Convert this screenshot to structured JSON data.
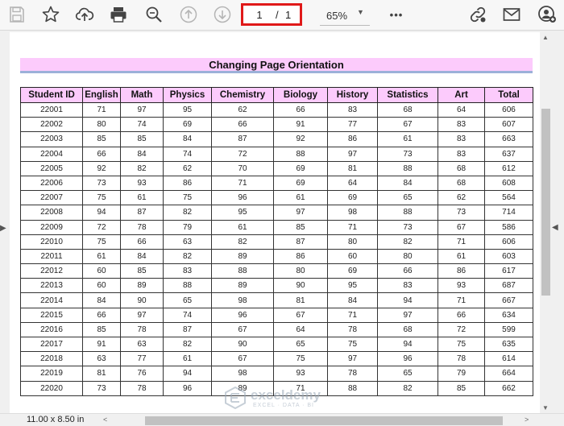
{
  "toolbar": {
    "icons": [
      "save-icon",
      "bookmark-star-icon",
      "upload-cloud-icon",
      "print-icon",
      "zoom-search-icon",
      "previous-page-icon",
      "next-page-icon",
      "more-icon",
      "share-link-icon",
      "email-icon",
      "account-icon"
    ],
    "page_current": "1",
    "page_separator": "/",
    "page_total": "1",
    "zoom_value": "65%",
    "more_label": "•••"
  },
  "status": {
    "page_size": "11.00 x 8.50 in"
  },
  "document": {
    "title": "Changing Page Orientation",
    "columns": [
      "Student ID",
      "English",
      "Math",
      "Physics",
      "Chemistry",
      "Biology",
      "History",
      "Statistics",
      "Art",
      "Total"
    ],
    "rows": [
      [
        "22001",
        "71",
        "97",
        "95",
        "62",
        "66",
        "83",
        "68",
        "64",
        "606"
      ],
      [
        "22002",
        "80",
        "74",
        "69",
        "66",
        "91",
        "77",
        "67",
        "83",
        "607"
      ],
      [
        "22003",
        "85",
        "85",
        "84",
        "87",
        "92",
        "86",
        "61",
        "83",
        "663"
      ],
      [
        "22004",
        "66",
        "84",
        "74",
        "72",
        "88",
        "97",
        "73",
        "83",
        "637"
      ],
      [
        "22005",
        "92",
        "82",
        "62",
        "70",
        "69",
        "81",
        "88",
        "68",
        "612"
      ],
      [
        "22006",
        "73",
        "93",
        "86",
        "71",
        "69",
        "64",
        "84",
        "68",
        "608"
      ],
      [
        "22007",
        "75",
        "61",
        "75",
        "96",
        "61",
        "69",
        "65",
        "62",
        "564"
      ],
      [
        "22008",
        "94",
        "87",
        "82",
        "95",
        "97",
        "98",
        "88",
        "73",
        "714"
      ],
      [
        "22009",
        "72",
        "78",
        "79",
        "61",
        "85",
        "71",
        "73",
        "67",
        "586"
      ],
      [
        "22010",
        "75",
        "66",
        "63",
        "82",
        "87",
        "80",
        "82",
        "71",
        "606"
      ],
      [
        "22011",
        "61",
        "84",
        "82",
        "89",
        "86",
        "60",
        "80",
        "61",
        "603"
      ],
      [
        "22012",
        "60",
        "85",
        "83",
        "88",
        "80",
        "69",
        "66",
        "86",
        "617"
      ],
      [
        "22013",
        "60",
        "89",
        "88",
        "89",
        "90",
        "95",
        "83",
        "93",
        "687"
      ],
      [
        "22014",
        "84",
        "90",
        "65",
        "98",
        "81",
        "84",
        "94",
        "71",
        "667"
      ],
      [
        "22015",
        "66",
        "97",
        "74",
        "96",
        "67",
        "71",
        "97",
        "66",
        "634"
      ],
      [
        "22016",
        "85",
        "78",
        "87",
        "67",
        "64",
        "78",
        "68",
        "72",
        "599"
      ],
      [
        "22017",
        "91",
        "63",
        "82",
        "90",
        "65",
        "75",
        "94",
        "75",
        "635"
      ],
      [
        "22018",
        "63",
        "77",
        "61",
        "67",
        "75",
        "97",
        "96",
        "78",
        "614"
      ],
      [
        "22019",
        "81",
        "76",
        "94",
        "98",
        "93",
        "78",
        "65",
        "79",
        "664"
      ],
      [
        "22020",
        "73",
        "78",
        "96",
        "89",
        "71",
        "88",
        "82",
        "85",
        "662"
      ]
    ]
  },
  "watermark": {
    "name": "exceldemy",
    "tagline": "EXCEL · DATA · BI"
  },
  "colors": {
    "header_fill": "#fccbfc",
    "title_fill": "#fccbfc",
    "title_underline": "#9cb1d9",
    "page_box_border": "#e01919"
  }
}
